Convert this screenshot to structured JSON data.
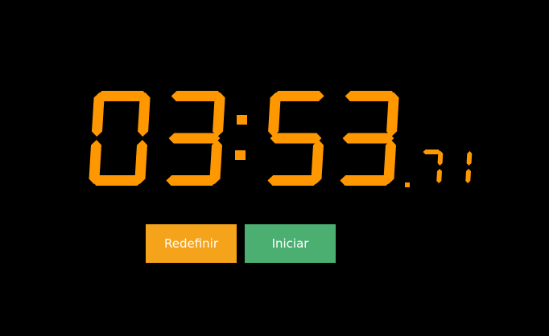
{
  "stopwatch": {
    "minutes": "03",
    "separator": ":",
    "seconds": "53",
    "decimal_point": ".",
    "hundredths": "71",
    "digit_color": "#ff9800"
  },
  "controls": {
    "reset_label": "Redefinir",
    "reset_color": "#f5a31a",
    "start_label": "Iniciar",
    "start_color": "#4caf72"
  }
}
